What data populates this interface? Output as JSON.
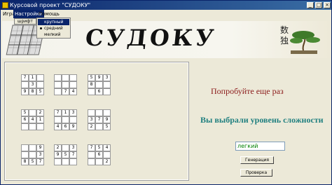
{
  "window": {
    "title": "Курсовой проект \"СУДОКУ\"",
    "buttons": {
      "minimize": "_",
      "maximize": "□",
      "close": "×"
    }
  },
  "menu": {
    "items": [
      "Игра",
      "Настройки",
      "Помощь"
    ],
    "dropdown_item": "шрифт",
    "submenu": [
      "крупный",
      "средний",
      "мелкий"
    ],
    "submenu_checked": "средний"
  },
  "banner": {
    "logo": "СУДОКУ",
    "kanji": [
      "数",
      "独"
    ]
  },
  "board": {
    "grid_values": [
      [
        "7",
        "1",
        "",
        "",
        "",
        "",
        "5",
        "9",
        "3"
      ],
      [
        "",
        "3",
        "",
        "",
        "",
        "",
        "8",
        "",
        ""
      ],
      [
        "9",
        "8",
        "5",
        "",
        "7",
        "4",
        "",
        "6",
        ""
      ],
      [
        "5",
        "",
        "2",
        "7",
        "1",
        "3",
        "",
        "",
        ""
      ],
      [
        "6",
        "4",
        "1",
        "",
        "",
        "",
        "3",
        "7",
        "9"
      ],
      [
        "",
        "",
        "",
        "4",
        "6",
        "9",
        "2",
        "",
        "5"
      ],
      [
        "",
        "",
        "9",
        "2",
        "",
        "3",
        "7",
        "5",
        "4"
      ],
      [
        "",
        "",
        "3",
        "9",
        "5",
        "7",
        "",
        "6",
        ""
      ],
      [
        "8",
        "5",
        "7",
        "",
        "",
        "",
        "",
        "",
        "2"
      ]
    ]
  },
  "messages": {
    "try_again": "Попробуйте еще раз",
    "level_chosen": "Вы выбрали уровень сложности"
  },
  "level_value": "легкий",
  "actions": {
    "generate": "Генерация",
    "check": "Проверка"
  },
  "colors": {
    "try_again": "#8b1a1a",
    "level_chosen": "#1f7f7f",
    "level_value": "#008000",
    "title_bar": "#0a246a"
  }
}
